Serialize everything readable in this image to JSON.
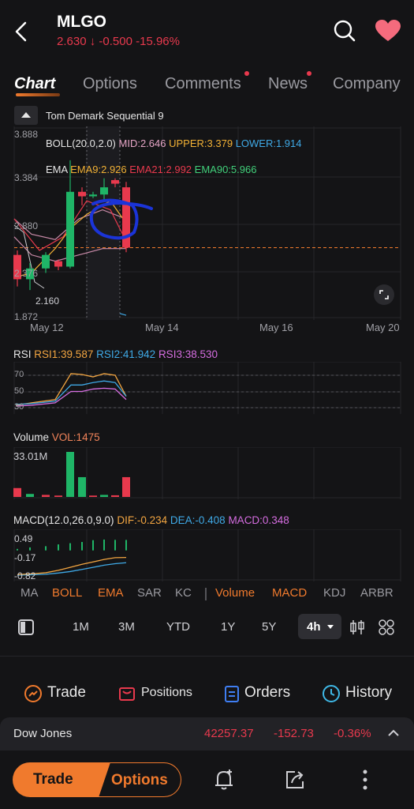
{
  "header": {
    "symbol": "MLGO",
    "price": "2.630",
    "arrow": "↓",
    "change": "-0.500",
    "change_pct": "-15.96%"
  },
  "tabs": [
    {
      "label": "Chart"
    },
    {
      "label": "Options"
    },
    {
      "label": "Comments"
    },
    {
      "label": "News"
    },
    {
      "label": "Company"
    }
  ],
  "chart": {
    "indicator_name": "Tom Demark Sequential 9",
    "boll_label": "BOLL(20.0,2.0)",
    "boll_mid": "MID:2.646",
    "boll_upper": "UPPER:3.379",
    "boll_lower": "LOWER:1.914",
    "ema_label": "EMA",
    "ema9": "EMA9:2.926",
    "ema21": "EMA21:2.992",
    "ema90": "EMA90:5.966",
    "price_ticks": [
      "3.888",
      "3.384",
      "2.880",
      "2.376",
      "1.872"
    ],
    "low_label": "2.160",
    "dates": [
      "May 12",
      "May 14",
      "May 16",
      "May 20"
    ]
  },
  "rsi": {
    "label": "RSI",
    "rsi1": "RSI1:39.587",
    "rsi2": "RSI2:41.942",
    "rsi3": "RSI3:38.530",
    "ticks": [
      "70",
      "50",
      "30"
    ]
  },
  "volume": {
    "label": "Volume",
    "vol": "VOL:1475",
    "max": "33.01M"
  },
  "macd": {
    "label": "MACD(12.0,26.0,9.0)",
    "dif": "DIF:-0.234",
    "dea": "DEA:-0.408",
    "macd": "MACD:0.348",
    "ticks": [
      "0.49",
      "-0.17",
      "-0.82"
    ]
  },
  "indicator_bar": [
    "MA",
    "BOLL",
    "EMA",
    "SAR",
    "KC",
    "Volume",
    "MACD",
    "KDJ",
    "ARBR"
  ],
  "periods": [
    "1M",
    "3M",
    "YTD",
    "1Y",
    "5Y",
    "4h"
  ],
  "actions": {
    "trade": "Trade",
    "positions": "Positions",
    "orders": "Orders",
    "history": "History"
  },
  "ticker": {
    "name": "Dow Jones",
    "value": "42257.37",
    "change": "-152.73",
    "pct": "-0.36%"
  },
  "bottom": {
    "trade": "Trade",
    "options": "Options"
  },
  "colors": {
    "accent": "#f07a2d",
    "up": "#1fb567",
    "down": "#e8394d",
    "background": "#141416"
  },
  "chart_data": {
    "type": "candlestick",
    "candles": [
      {
        "open": 2.55,
        "close": 2.28,
        "high": 2.6,
        "low": 2.2
      },
      {
        "open": 2.28,
        "close": 2.4,
        "high": 2.46,
        "low": 2.16
      },
      {
        "open": 2.4,
        "close": 2.55,
        "high": 2.58,
        "low": 2.35
      },
      {
        "open": 2.48,
        "close": 2.42,
        "high": 2.5,
        "low": 2.38
      },
      {
        "open": 2.42,
        "close": 3.25,
        "high": 3.6,
        "low": 2.4
      },
      {
        "open": 3.25,
        "close": 3.2,
        "high": 3.3,
        "low": 3.1
      },
      {
        "open": 3.2,
        "close": 3.22,
        "high": 3.25,
        "low": 3.18
      },
      {
        "open": 3.22,
        "close": 3.3,
        "high": 3.4,
        "low": 3.15
      },
      {
        "open": 3.38,
        "close": 3.34,
        "high": 3.4,
        "low": 3.3
      },
      {
        "open": 3.3,
        "close": 2.63,
        "high": 3.36,
        "low": 2.58
      }
    ],
    "rsi": {
      "rsi1": [
        33,
        36,
        40,
        72,
        71,
        68,
        72,
        70,
        44
      ],
      "rsi2": [
        34,
        35,
        38,
        58,
        58,
        61,
        63,
        61,
        44
      ],
      "rsi3": [
        32,
        33,
        36,
        50,
        50,
        53,
        54,
        53,
        40
      ]
    },
    "volume": [
      {
        "v": 6.5,
        "dir": "down"
      },
      {
        "v": 2.2,
        "dir": "up"
      },
      {
        "v": 1.5,
        "dir": "down"
      },
      {
        "v": 1.0,
        "dir": "down"
      },
      {
        "v": 33.01,
        "dir": "up"
      },
      {
        "v": 14.5,
        "dir": "up"
      },
      {
        "v": 1.0,
        "dir": "down"
      },
      {
        "v": 1.5,
        "dir": "up"
      },
      {
        "v": 1.2,
        "dir": "down"
      },
      {
        "v": 14.5,
        "dir": "down"
      }
    ],
    "macd_hist": [
      0.05,
      0.1,
      0.14,
      0.2,
      0.24,
      0.28,
      0.34,
      0.36,
      0.35,
      0.348
    ],
    "dif": [
      -0.8,
      -0.78,
      -0.74,
      -0.66,
      -0.56,
      -0.46,
      -0.38,
      -0.3,
      -0.24,
      -0.234
    ],
    "dea": [
      -0.82,
      -0.81,
      -0.79,
      -0.75,
      -0.7,
      -0.63,
      -0.56,
      -0.49,
      -0.44,
      -0.408
    ]
  }
}
